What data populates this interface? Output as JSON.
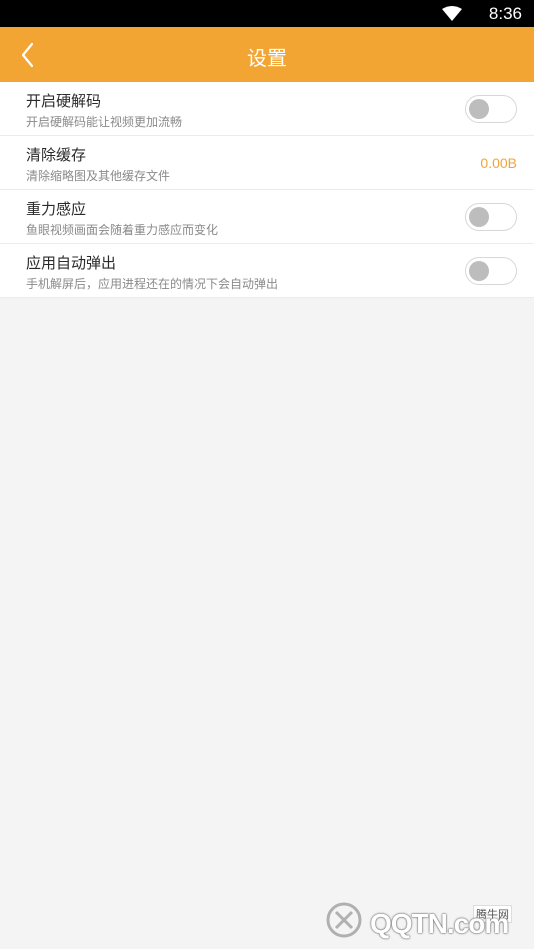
{
  "status_bar": {
    "time": "8:36"
  },
  "header": {
    "title": "设置"
  },
  "settings": [
    {
      "title": "开启硬解码",
      "subtitle": "开启硬解码能让视频更加流畅",
      "toggle_on": false
    },
    {
      "title": "清除缓存",
      "subtitle": "清除缩略图及其他缓存文件",
      "value": "0.00B"
    },
    {
      "title": "重力感应",
      "subtitle": "鱼眼视频画面会随着重力感应而变化",
      "toggle_on": false
    },
    {
      "title": "应用自动弹出",
      "subtitle": "手机解屏后，应用进程还在的情况下会自动弹出",
      "toggle_on": false
    }
  ],
  "watermark": {
    "label": "腾牛网",
    "text": "QQTN.com"
  },
  "colors": {
    "accent": "#f3a533",
    "toggle_knob": "#bdbdbd"
  },
  "icons": {
    "back": "chevron-left-icon",
    "wifi": "wifi-icon"
  }
}
